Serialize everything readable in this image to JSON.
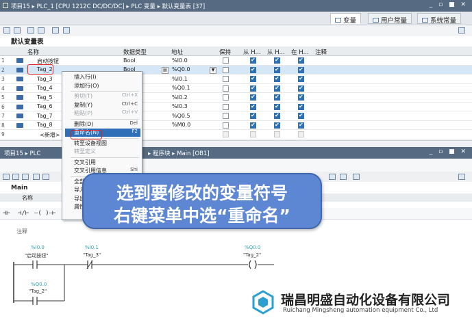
{
  "title_bar": {
    "crumbs": "项目15 ▸ PLC_1 [CPU 1212C DC/DC/DC] ▸ PLC 变量 ▸ 默认变量表 [37]",
    "win_controls": "_ ▫ ■ ✕"
  },
  "view_tabs": [
    {
      "label": "变量"
    },
    {
      "label": "用户常量"
    },
    {
      "label": "系统常量"
    }
  ],
  "table_title": "默认变量表",
  "columns": [
    "名称",
    "数据类型",
    "地址",
    "保持",
    "从 H...",
    "从 H...",
    "在 H...",
    "注释"
  ],
  "rows": [
    {
      "num": "1",
      "name": "启动按钮",
      "type": "Bool",
      "address": "%I0.0",
      "retain": false,
      "c1": true,
      "c2": true,
      "c3": true
    },
    {
      "num": "2",
      "name": "Tag_2",
      "type": "Bool",
      "address": "%Q0.0",
      "retain": false,
      "c1": true,
      "c2": true,
      "c3": true
    },
    {
      "num": "3",
      "name": "Tag_3",
      "type": "",
      "address": "%I0.1",
      "retain": false,
      "c1": true,
      "c2": true,
      "c3": true
    },
    {
      "num": "4",
      "name": "Tag_4",
      "type": "",
      "address": "%Q0.1",
      "retain": false,
      "c1": true,
      "c2": true,
      "c3": true
    },
    {
      "num": "5",
      "name": "Tag_5",
      "type": "",
      "address": "%I0.2",
      "retain": false,
      "c1": true,
      "c2": true,
      "c3": true
    },
    {
      "num": "6",
      "name": "Tag_6",
      "type": "",
      "address": "%I0.3",
      "retain": false,
      "c1": true,
      "c2": true,
      "c3": true
    },
    {
      "num": "7",
      "name": "Tag_7",
      "type": "",
      "address": "%Q0.5",
      "retain": false,
      "c1": true,
      "c2": true,
      "c3": true
    },
    {
      "num": "8",
      "name": "Tag_8",
      "type": "",
      "address": "%M0.0",
      "retain": false,
      "c1": true,
      "c2": true,
      "c3": true
    },
    {
      "num": "9",
      "name": "<新增>",
      "type": "",
      "address": "",
      "retain": null,
      "c1": null,
      "c2": null,
      "c3": null
    }
  ],
  "context_menu": [
    {
      "label": "插入行(I)",
      "key": "",
      "state": "normal"
    },
    {
      "label": "添加行(O)",
      "key": "",
      "state": "normal"
    },
    {
      "label": "剪切(T)",
      "key": "Ctrl+X",
      "state": "disabled"
    },
    {
      "label": "复制(Y)",
      "key": "Ctrl+C",
      "state": "normal"
    },
    {
      "label": "粘贴(P)",
      "key": "Ctrl+V",
      "state": "disabled"
    },
    {
      "label": "删除(D)",
      "key": "Del",
      "state": "normal"
    },
    {
      "label": "重命名(N)",
      "key": "F2",
      "state": "highlighted"
    },
    {
      "label": "转至设备视图",
      "key": "",
      "state": "normal"
    },
    {
      "label": "转至定义",
      "key": "",
      "state": "disabled"
    },
    {
      "label": "交叉引用",
      "key": "",
      "state": "normal"
    },
    {
      "label": "交叉引用信息",
      "key": "Shi",
      "state": "normal"
    },
    {
      "label": "全部",
      "key": "",
      "state": "normal"
    },
    {
      "label": "导入",
      "key": "",
      "state": "normal"
    },
    {
      "label": "导出",
      "key": "",
      "state": "normal"
    },
    {
      "label": "属性",
      "key": "",
      "state": "normal"
    }
  ],
  "program_bar": {
    "crumbs_left": "项目15 ▸ PLC",
    "crumbs_right": "▸ 程序块 ▸ Main [OB1]",
    "win_controls": "_ ▫ ■ ✕"
  },
  "block": {
    "title": "Main",
    "name_header": "名称",
    "comment": "注释"
  },
  "ladder": {
    "contact1_addr": "%I0.0",
    "contact1_name": "\"启动按钮\"",
    "contact2_addr": "%I0.1",
    "contact2_name": "\"Tag_3\"",
    "coil_addr": "%Q0.0",
    "coil_name": "\"Tag_2\"",
    "branch_addr": "%Q0.0",
    "branch_name": "\"Tag_2\""
  },
  "callout": {
    "line1": "选到要修改的变量符号",
    "line2": "右键菜单中选“重命名”"
  },
  "watermark": {
    "company_cn": "瑞昌明盛自动化设备有限公司",
    "company_en": "Ruichang Mingsheng automation equipment Co., Ltd"
  },
  "colors": {
    "titlebar": "#566b82",
    "selection": "#2e6fb8",
    "callout": "#5d87d3",
    "annotation_red": "#e02020",
    "checkbox": "#2f6fb3"
  }
}
